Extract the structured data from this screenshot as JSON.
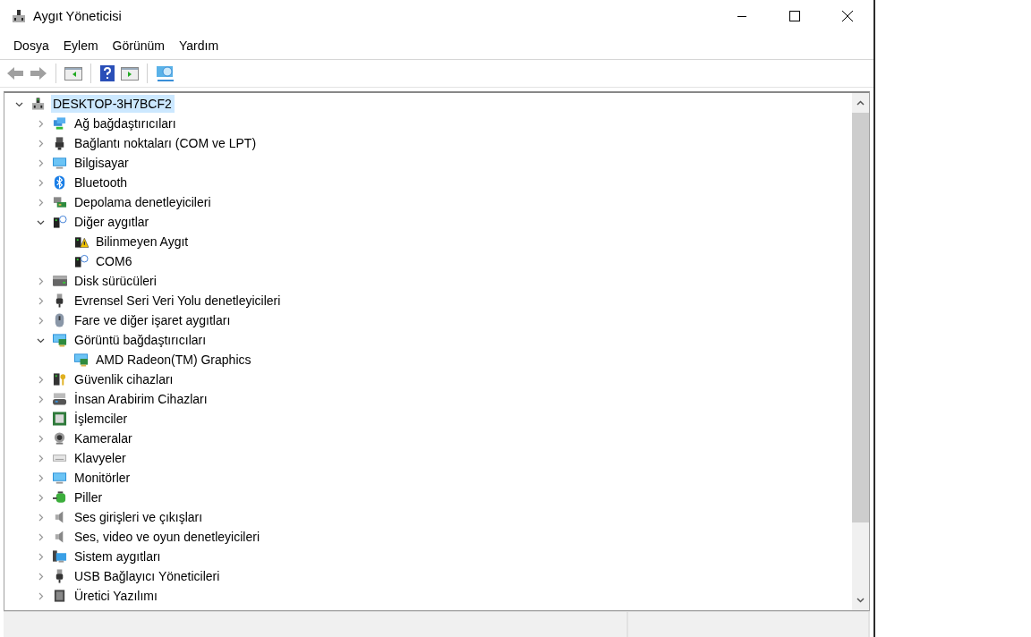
{
  "window": {
    "title": "Aygıt Yöneticisi"
  },
  "menu": [
    {
      "label": "Dosya"
    },
    {
      "label": "Eylem"
    },
    {
      "label": "Görünüm"
    },
    {
      "label": "Yardım"
    }
  ],
  "tree": {
    "label": "DESKTOP-3H7BCF2",
    "kind": "computer",
    "expanded": true,
    "selected": true,
    "children": [
      {
        "label": "Ağ bağdaştırıcıları",
        "kind": "network",
        "expanded": false
      },
      {
        "label": "Bağlantı noktaları (COM ve LPT)",
        "kind": "port",
        "expanded": false
      },
      {
        "label": "Bilgisayar",
        "kind": "monitor",
        "expanded": false
      },
      {
        "label": "Bluetooth",
        "kind": "bluetooth",
        "expanded": false
      },
      {
        "label": "Depolama denetleyicileri",
        "kind": "storage",
        "expanded": false
      },
      {
        "label": "Diğer aygıtlar",
        "kind": "unknown",
        "expanded": true,
        "children": [
          {
            "label": "Bilinmeyen Aygıt",
            "kind": "warning"
          },
          {
            "label": "COM6",
            "kind": "unknown"
          }
        ]
      },
      {
        "label": "Disk sürücüleri",
        "kind": "disk",
        "expanded": false
      },
      {
        "label": "Evrensel Seri Veri Yolu denetleyicileri",
        "kind": "usb",
        "expanded": false
      },
      {
        "label": "Fare ve diğer işaret aygıtları",
        "kind": "mouse",
        "expanded": false
      },
      {
        "label": "Görüntü bağdaştırıcıları",
        "kind": "display",
        "expanded": true,
        "children": [
          {
            "label": "AMD Radeon(TM) Graphics",
            "kind": "display"
          }
        ]
      },
      {
        "label": "Güvenlik cihazları",
        "kind": "security",
        "expanded": false
      },
      {
        "label": "İnsan Arabirim Cihazları",
        "kind": "hid",
        "expanded": false
      },
      {
        "label": "İşlemciler",
        "kind": "cpu",
        "expanded": false
      },
      {
        "label": "Kameralar",
        "kind": "camera",
        "expanded": false
      },
      {
        "label": "Klavyeler",
        "kind": "keyboard",
        "expanded": false
      },
      {
        "label": "Monitörler",
        "kind": "monitor",
        "expanded": false
      },
      {
        "label": "Piller",
        "kind": "battery",
        "expanded": false
      },
      {
        "label": "Ses girişleri ve çıkışları",
        "kind": "speaker",
        "expanded": false
      },
      {
        "label": "Ses, video ve oyun denetleyicileri",
        "kind": "speaker",
        "expanded": false
      },
      {
        "label": "Sistem aygıtları",
        "kind": "system",
        "expanded": false
      },
      {
        "label": "USB Bağlayıcı Yöneticileri",
        "kind": "usb",
        "expanded": false
      },
      {
        "label": "Üretici Yazılımı",
        "kind": "firmware",
        "expanded": false
      }
    ]
  }
}
